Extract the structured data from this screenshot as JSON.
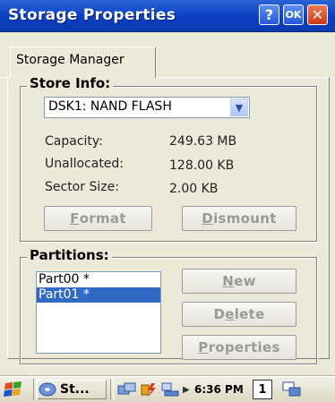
{
  "window": {
    "title": "Storage Properties",
    "help_label": "?",
    "ok_label": "OK",
    "close_label": "✕"
  },
  "tabs": [
    {
      "label": "Storage Manager",
      "selected": true
    }
  ],
  "store_info": {
    "group_label": "Store Info:",
    "selected_store": "DSK1: NAND FLASH",
    "capacity_label": "Capacity:",
    "capacity_value": "249.63 MB",
    "unallocated_label": "Unallocated:",
    "unallocated_value": "128.00 KB",
    "sector_size_label": "Sector Size:",
    "sector_size_value": "2.00 KB",
    "format_button": {
      "prefix": "",
      "accel": "F",
      "rest": "ormat"
    },
    "dismount_button": {
      "prefix": "",
      "accel": "D",
      "rest": "ismount"
    }
  },
  "partitions": {
    "group_label": "Partitions:",
    "items": [
      {
        "label": "Part00 *",
        "selected": false
      },
      {
        "label": "Part01 *",
        "selected": true
      }
    ],
    "new_button": {
      "prefix": "",
      "accel": "N",
      "rest": "ew"
    },
    "delete_button": {
      "prefix": "D",
      "accel": "e",
      "rest": "lete"
    },
    "properties_button": {
      "prefix": "",
      "accel": "P",
      "rest": "roperties"
    }
  },
  "taskbar": {
    "start_icon": "windows-flag-icon",
    "task_label": "St...",
    "clock": "6:36 PM",
    "input_indicator": "1",
    "colors": {
      "start_flag": "#e8a317",
      "selection": "#316ac5"
    }
  }
}
